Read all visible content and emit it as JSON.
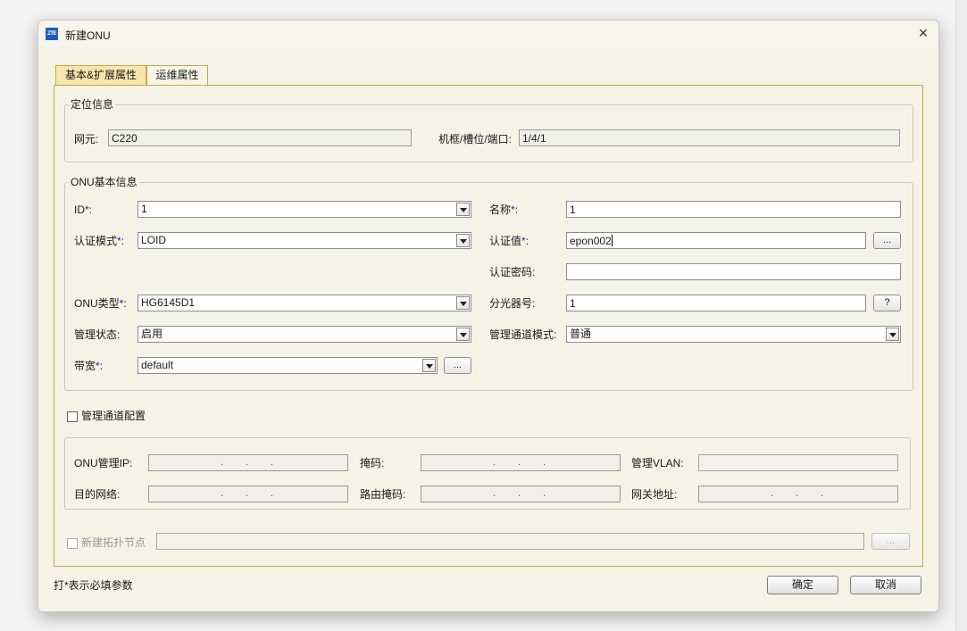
{
  "dialog": {
    "app_icon_text": "ZTE",
    "title": "新建ONU",
    "close_glyph": "×"
  },
  "tabs": [
    {
      "label": "基本&扩展属性",
      "active": true
    },
    {
      "label": "运维属性",
      "active": false
    }
  ],
  "location": {
    "legend": "定位信息",
    "ne_label": "网元:",
    "ne_value": "C220",
    "port_label": "机框/槽位/端口:",
    "port_value": "1/4/1"
  },
  "onu_basic": {
    "legend": "ONU基本信息",
    "required_mark": "*",
    "id": {
      "label": "ID",
      "suffix": ":",
      "value": "1"
    },
    "name": {
      "label": "名称",
      "suffix": ":",
      "value": "1"
    },
    "auth_mode": {
      "label": "认证模式",
      "suffix": ":",
      "value": "LOID"
    },
    "auth_value": {
      "label": "认证值",
      "suffix": ":",
      "value": "epon002",
      "more": "..."
    },
    "auth_password": {
      "label": "认证密码:",
      "value": ""
    },
    "onu_type": {
      "label": "ONU类型",
      "suffix": ":",
      "value": "HG6145D1"
    },
    "splitter": {
      "label": "分光器号:",
      "value": "1",
      "help": "?"
    },
    "admin_state": {
      "label": "管理状态:",
      "value": "启用"
    },
    "mgmt_channel_mode": {
      "label": "管理通道模式:",
      "value": "普通"
    },
    "bandwidth": {
      "label": "带宽",
      "suffix": ":",
      "value": "default",
      "more": "..."
    }
  },
  "mgmt_channel": {
    "checkbox_label": "管理通道配置",
    "checked": false,
    "onu_mgmt_ip_label": "ONU管理IP:",
    "mask_label": "掩码:",
    "mgmt_vlan_label": "管理VLAN:",
    "dest_network_label": "目的网络:",
    "route_mask_label": "路由掩码:",
    "gateway_label": "网关地址:",
    "ip_dot": "."
  },
  "topology": {
    "checkbox_label": "新建拓扑节点",
    "checked": false,
    "value": "",
    "more": "..."
  },
  "footer": {
    "note": "打*表示必填参数",
    "ok_label": "确定",
    "cancel_label": "取消"
  }
}
